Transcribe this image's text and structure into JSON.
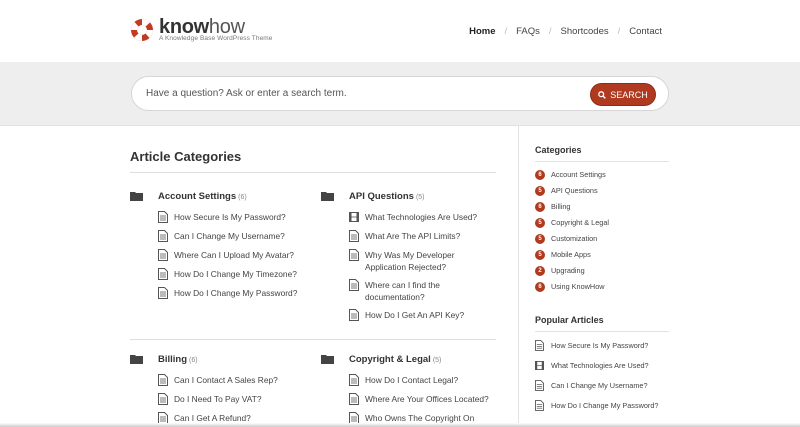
{
  "header": {
    "logo_bold": "know",
    "logo_light": "how",
    "tagline": "A Knowledge Base WordPress Theme",
    "nav": [
      {
        "label": "Home"
      },
      {
        "label": "FAQs"
      },
      {
        "label": "Shortcodes"
      },
      {
        "label": "Contact"
      }
    ],
    "nav_separator": "/"
  },
  "search": {
    "placeholder": "Have a question? Ask or enter a search term.",
    "button_label": "SEARCH"
  },
  "main": {
    "title": "Article Categories",
    "categories": [
      {
        "title": "Account Settings",
        "count": "(6)",
        "articles": [
          {
            "label": "How Secure Is My Password?",
            "icon": "document-icon"
          },
          {
            "label": "Can I Change My Username?",
            "icon": "document-icon"
          },
          {
            "label": "Where Can I Upload My Avatar?",
            "icon": "document-icon"
          },
          {
            "label": "How Do I Change My Timezone?",
            "icon": "document-icon"
          },
          {
            "label": "How Do I Change My Password?",
            "icon": "document-icon"
          }
        ]
      },
      {
        "title": "API Questions",
        "count": "(5)",
        "articles": [
          {
            "label": "What Technologies Are Used?",
            "icon": "film-icon"
          },
          {
            "label": "What Are The API Limits?",
            "icon": "document-icon"
          },
          {
            "label": "Why Was My Developer",
            "label2": "Application Rejected?",
            "icon": "document-icon"
          },
          {
            "label": "Where can I find the",
            "label2": "documentation?",
            "icon": "document-icon"
          },
          {
            "label": "How Do I Get An API Key?",
            "icon": "document-icon"
          }
        ]
      },
      {
        "title": "Billing",
        "count": "(6)",
        "articles": [
          {
            "label": "Can I Contact A Sales Rep?",
            "icon": "document-icon"
          },
          {
            "label": "Do I Need To Pay VAT?",
            "icon": "document-icon"
          },
          {
            "label": "Can I Get A Refund?",
            "icon": "document-icon"
          }
        ]
      },
      {
        "title": "Copyright & Legal",
        "count": "(5)",
        "articles": [
          {
            "label": "How Do I Contact Legal?",
            "icon": "document-icon"
          },
          {
            "label": "Where Are Your Offices Located?",
            "icon": "document-icon"
          },
          {
            "label": "Who Owns The Copyright On",
            "icon": "document-icon"
          }
        ]
      }
    ]
  },
  "sidebar": {
    "categories_title": "Categories",
    "categories": [
      {
        "count": "6",
        "label": "Account Settings"
      },
      {
        "count": "5",
        "label": "API Questions"
      },
      {
        "count": "6",
        "label": "Billing"
      },
      {
        "count": "5",
        "label": "Copyright & Legal"
      },
      {
        "count": "5",
        "label": "Customization"
      },
      {
        "count": "5",
        "label": "Mobile Apps"
      },
      {
        "count": "2",
        "label": "Upgrading"
      },
      {
        "count": "6",
        "label": "Using KnowHow"
      }
    ],
    "popular_title": "Popular Articles",
    "popular": [
      {
        "label": "How Secure Is My Password?",
        "icon": "document-icon"
      },
      {
        "label": "What Technologies Are Used?",
        "icon": "film-icon"
      },
      {
        "label": "Can I Change My Username?",
        "icon": "document-icon"
      },
      {
        "label": "How Do I Change My Password?",
        "icon": "document-icon"
      }
    ]
  },
  "colors": {
    "accent": "#b03a1f",
    "search_band": "#eeeeee"
  }
}
